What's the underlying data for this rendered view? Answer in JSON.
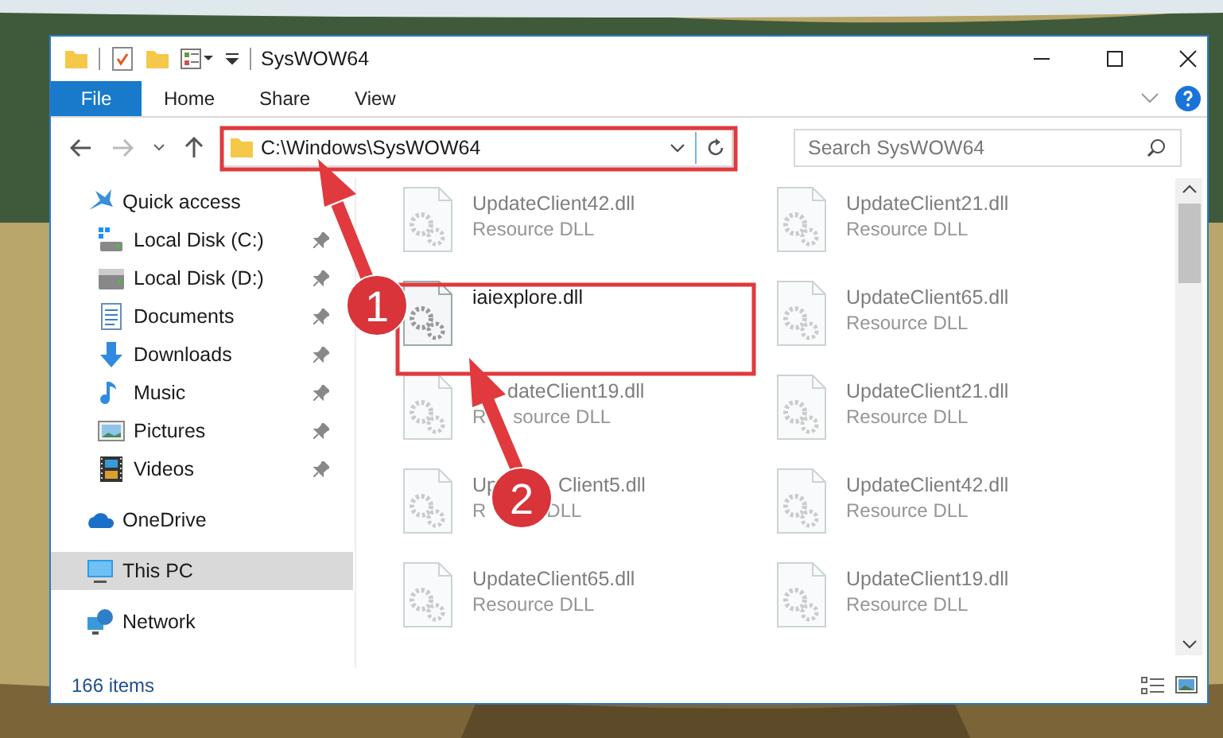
{
  "window": {
    "title": "SysWOW64"
  },
  "ribbon": {
    "tabs": [
      {
        "label": "File",
        "kind": "menu"
      },
      {
        "label": "Home",
        "kind": "tab"
      },
      {
        "label": "Share",
        "kind": "tab"
      },
      {
        "label": "View",
        "kind": "tab"
      }
    ]
  },
  "address": {
    "path": "C:\\Windows\\SysWOW64"
  },
  "search": {
    "placeholder": "Search SysWOW64"
  },
  "sidebar": {
    "items": [
      {
        "label": "Quick access",
        "kind": "star",
        "selected": false,
        "children": [
          {
            "label": "Local Disk (C:)",
            "kind": "system-drive",
            "pinned": true,
            "selected": false
          },
          {
            "label": "Local Disk (D:)",
            "kind": "drive",
            "pinned": true,
            "selected": false
          },
          {
            "label": "Documents",
            "kind": "documents",
            "pinned": true,
            "selected": false
          },
          {
            "label": "Downloads",
            "kind": "downloads",
            "pinned": true,
            "selected": false
          },
          {
            "label": "Music",
            "kind": "music",
            "pinned": true,
            "selected": false
          },
          {
            "label": "Pictures",
            "kind": "pictures",
            "pinned": true,
            "selected": false
          },
          {
            "label": "Videos",
            "kind": "videos",
            "pinned": true,
            "selected": false
          }
        ]
      },
      {
        "label": "OneDrive",
        "kind": "cloud",
        "selected": false
      },
      {
        "label": "This PC",
        "kind": "computer",
        "selected": true
      },
      {
        "label": "Network",
        "kind": "network",
        "selected": false
      }
    ]
  },
  "files": [
    {
      "kind": "plain",
      "name": [
        "UpdateClient42.dll"
      ],
      "type": [
        "Resource DLL"
      ],
      "blurred": true
    },
    {
      "kind": "plain",
      "name": [
        "UpdateClient21.dll"
      ],
      "type": [
        "Resource DLL"
      ],
      "blurred": true
    },
    {
      "kind": "plain",
      "name": [
        "iaiexplore.dll"
      ],
      "blurred": false
    },
    {
      "kind": "plain",
      "name": [
        "UpdateClient65.dll"
      ],
      "type": [
        "Resource DLL"
      ],
      "blurred": true
    },
    {
      "kind": "arrowed",
      "name": [
        "dateClient19.dll"
      ],
      "type": [
        "R",
        "source DLL"
      ],
      "blurred": true
    },
    {
      "kind": "plain",
      "name": [
        "UpdateClient21.dll"
      ],
      "type": [
        "Resource DLL"
      ],
      "blurred": true
    },
    {
      "kind": "badged",
      "name": [
        "Up",
        "Client5.dll"
      ],
      "type": [
        "R",
        "DLL"
      ],
      "blurred": true
    },
    {
      "kind": "plain",
      "name": [
        "UpdateClient42.dll"
      ],
      "type": [
        "Resource DLL"
      ],
      "blurred": true
    },
    {
      "kind": "plain",
      "name": [
        "UpdateClient65.dll"
      ],
      "type": [
        "Resource DLL"
      ],
      "blurred": true
    },
    {
      "kind": "plain",
      "name": [
        "UpdateClient19.dll"
      ],
      "type": [
        "Resource DLL"
      ],
      "blurred": true
    }
  ],
  "status_bar": {
    "item_count": "166 items"
  },
  "annotations": [
    {
      "number": "1"
    },
    {
      "number": "2"
    }
  ]
}
